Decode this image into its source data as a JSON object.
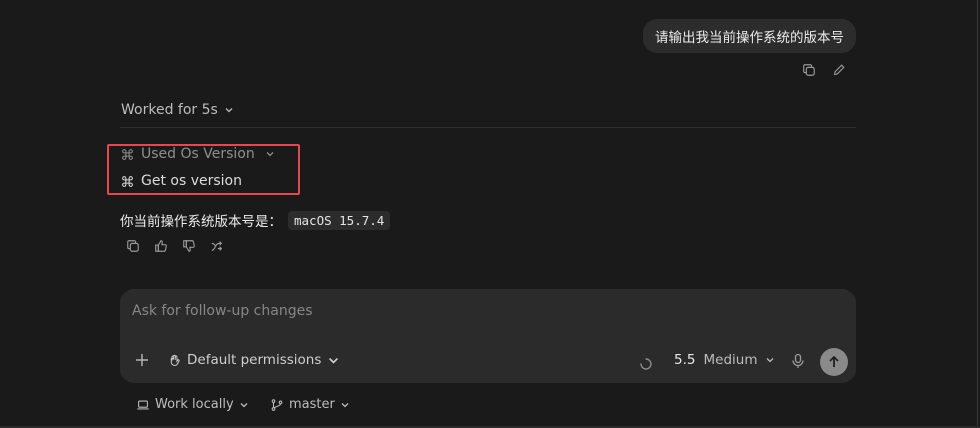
{
  "user_message": {
    "text": "请输出我当前操作系统的版本号"
  },
  "message_actions": {
    "copy_icon": "copy-icon",
    "edit_icon": "pencil-icon"
  },
  "worked": {
    "label": "Worked for 5s"
  },
  "tools": {
    "used": {
      "label": "Used Os Version",
      "icon": "command-icon"
    },
    "get": {
      "label": "Get os version",
      "icon": "command-icon"
    },
    "highlight_color": "#e5484d"
  },
  "answer": {
    "prefix": "你当前操作系统版本号是：",
    "code": "macOS 15.7.4"
  },
  "answer_actions": [
    "copy-icon",
    "thumbs-up-icon",
    "thumbs-down-icon",
    "branch-icon"
  ],
  "composer": {
    "placeholder": "Ask for follow-up changes",
    "permissions_label": "Default permissions",
    "model_version": "5.5",
    "model_effort": "Medium"
  },
  "footer": {
    "work_label": "Work locally",
    "branch_label": "master"
  }
}
